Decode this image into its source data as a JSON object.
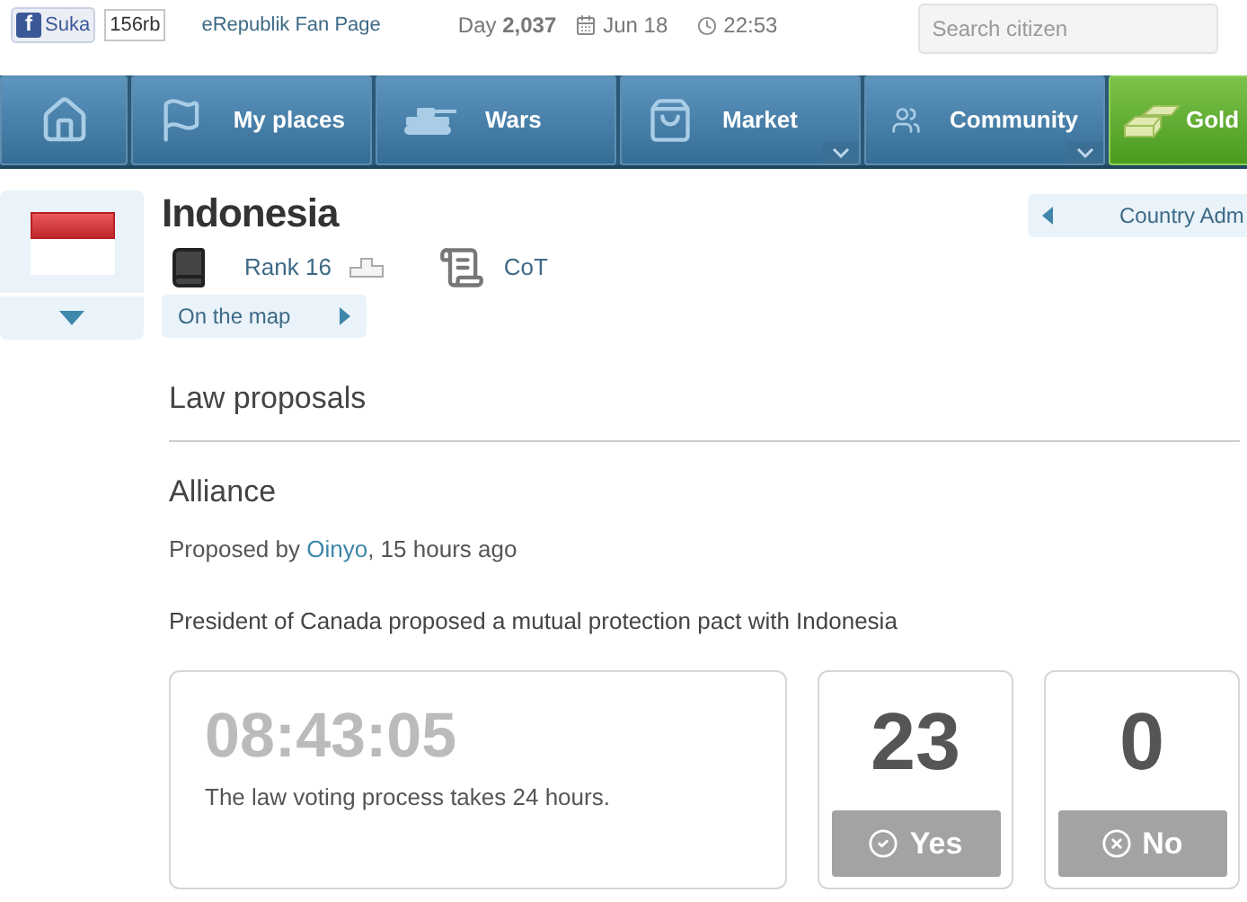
{
  "top_bar": {
    "like_button": {
      "logo": "f",
      "label": "Suka"
    },
    "like_count": "156rb",
    "fan_page_link": "eRepublik Fan Page",
    "day": "Day **2,037**",
    "date": "Jun 18",
    "time": "22:53",
    "search": {
      "placeholder": "Search citizen"
    }
  },
  "nav": [
    {
      "kind": "home",
      "has_menu": false
    },
    {
      "kind": "places",
      "label": "My places",
      "has_menu": false
    },
    {
      "kind": "wars",
      "label": "Wars",
      "has_menu": false
    },
    {
      "kind": "market",
      "label": "Market",
      "has_menu": true
    },
    {
      "kind": "community",
      "label": "Community",
      "has_menu": true
    },
    {
      "kind": "gold",
      "label": "Gold",
      "has_menu": false
    }
  ],
  "country": {
    "name": "Indonesia",
    "rank": "Rank 16",
    "party": "CoT",
    "map_link": "On the map",
    "admin_button": "Country Adm"
  },
  "section_title": "Law proposals",
  "proposal": {
    "title": "Alliance",
    "proposed_prefix": "Proposed by ",
    "proposer": "Oinyo",
    "proposed_suffix": ", 15 hours ago",
    "description": "President of Canada proposed a mutual protection pact with Indonesia",
    "countdown": "08:43:05",
    "countdown_note": "The law voting process takes 24 hours.",
    "votes": [
      {
        "kind": "yes",
        "count": "23",
        "label": "Yes",
        "disabled": true
      },
      {
        "kind": "no",
        "count": "0",
        "label": "No",
        "disabled": true
      }
    ]
  }
}
